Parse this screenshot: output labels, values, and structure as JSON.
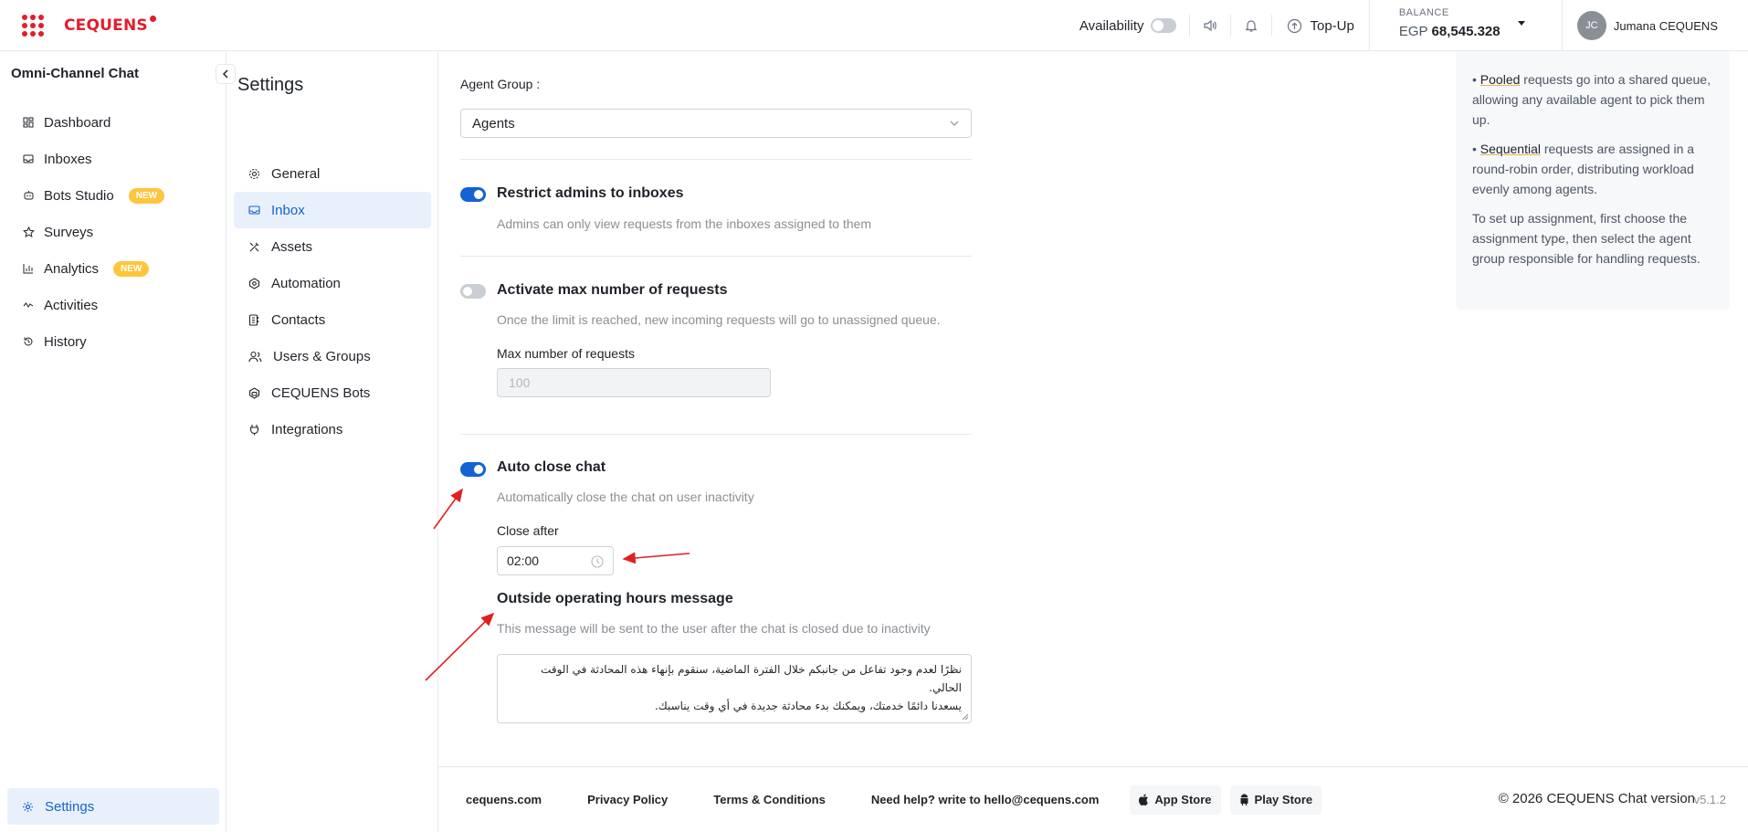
{
  "topbar": {
    "logo": "CEQUENS",
    "availability_label": "Availability",
    "topup_label": "Top-Up",
    "balance_label": "BALANCE",
    "balance_currency": "EGP",
    "balance_value": "68,545.328",
    "user_initials": "JC",
    "user_name": "Jumana CEQUENS"
  },
  "sidebar": {
    "title": "Omni-Channel Chat",
    "items": [
      {
        "label": "Dashboard",
        "icon": "dashboard-icon"
      },
      {
        "label": "Inboxes",
        "icon": "inbox-icon"
      },
      {
        "label": "Bots Studio",
        "icon": "bot-icon",
        "badge": "NEW"
      },
      {
        "label": "Surveys",
        "icon": "star-icon"
      },
      {
        "label": "Analytics",
        "icon": "bar-chart-icon",
        "badge": "NEW"
      },
      {
        "label": "Activities",
        "icon": "activity-icon"
      },
      {
        "label": "History",
        "icon": "history-icon"
      }
    ],
    "settings_label": "Settings"
  },
  "settings_nav": {
    "title": "Settings",
    "items": [
      {
        "label": "General",
        "active": false
      },
      {
        "label": "Inbox",
        "active": true
      },
      {
        "label": "Assets",
        "active": false
      },
      {
        "label": "Automation",
        "active": false
      },
      {
        "label": "Contacts",
        "active": false
      },
      {
        "label": "Users & Groups",
        "active": false
      },
      {
        "label": "CEQUENS Bots",
        "active": false
      },
      {
        "label": "Integrations",
        "active": false
      }
    ]
  },
  "main": {
    "agent_group_label": "Agent Group :",
    "agent_group_value": "Agents",
    "restrict_admins": {
      "title": "Restrict admins to inboxes",
      "description": "Admins can only view requests from the inboxes assigned to them",
      "enabled": true
    },
    "max_requests": {
      "title": "Activate max number of requests",
      "description": "Once the limit is reached, new incoming requests will go to unassigned queue.",
      "enabled": false,
      "field_label": "Max number of requests",
      "field_placeholder": "100"
    },
    "auto_close": {
      "title": "Auto close chat",
      "description": "Automatically close the chat on user inactivity",
      "enabled": true,
      "close_after_label": "Close after",
      "close_after_value": "02:00"
    },
    "outside_hours": {
      "title": "Outside operating hours message",
      "description": "This message will be sent to the user after the chat is closed due to inactivity",
      "message_line1": "نظرًا لعدم وجود تفاعل من جانبكم خلال الفترة الماضية، سنقوم بإنهاء هذه المحادثة في الوقت الحالي.",
      "message_line2": "يسعدنا دائمًا خدمتك، ويمكنك بدء محادثة جديدة في أي وقت يناسبك."
    }
  },
  "info_panel": {
    "pooled_term": "Pooled",
    "pooled_text": " requests go into a shared queue, allowing any available agent to pick them up.",
    "sequential_term": "Sequential",
    "sequential_text": " requests are assigned in a round-robin order, distributing workload evenly among agents.",
    "setup_text": "To set up assignment, first choose the assignment type, then select the agent group responsible for handling requests."
  },
  "footer": {
    "site": "cequens.com",
    "privacy": "Privacy Policy",
    "terms": "Terms & Conditions",
    "help": "Need help? write to hello@cequens.com",
    "app_store": "App Store",
    "play_store": "Play Store",
    "copyright": "© 2026 CEQUENS Chat version",
    "version": "v5.1.2"
  },
  "colors": {
    "brand": "#e31d2b",
    "accent": "#1463d2",
    "badge": "#ffc53d",
    "annotation": "#e02020"
  }
}
